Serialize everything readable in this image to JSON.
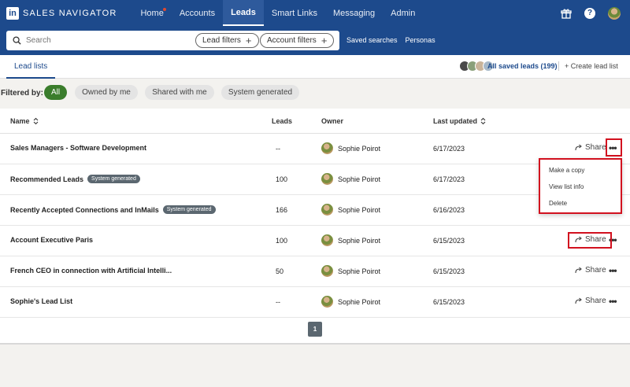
{
  "brand": {
    "logo": "in",
    "name": "SALES NAVIGATOR"
  },
  "nav": [
    {
      "label": "Home",
      "active": false,
      "dot": true
    },
    {
      "label": "Accounts",
      "active": false,
      "dot": false
    },
    {
      "label": "Leads",
      "active": true,
      "dot": false
    },
    {
      "label": "Smart Links",
      "active": false,
      "dot": false
    },
    {
      "label": "Messaging",
      "active": false,
      "dot": false
    },
    {
      "label": "Admin",
      "active": false,
      "dot": false
    }
  ],
  "topright": {
    "help_glyph": "?",
    "icons": [
      "gift-icon",
      "help-icon",
      "avatar"
    ]
  },
  "search": {
    "placeholder": "Search",
    "lead_filters": "Lead filters",
    "account_filters": "Account filters",
    "plus": "+"
  },
  "saved": {
    "searches": "Saved searches",
    "personas": "Personas"
  },
  "tabs": {
    "lead_lists": "Lead lists"
  },
  "leads_summary": {
    "all_saved": "All saved leads (199)",
    "create": "+ Create lead list"
  },
  "filters": {
    "label": "Filtered by:",
    "chips": [
      "All",
      "Owned by me",
      "Shared with me",
      "System generated"
    ]
  },
  "table": {
    "headers": {
      "name": "Name",
      "leads": "Leads",
      "owner": "Owner",
      "updated": "Last updated"
    },
    "rows": [
      {
        "name": "Sales Managers - Software Development",
        "badge": "",
        "leads": "--",
        "owner": "Sophie Poirot",
        "updated": "6/17/2023",
        "share": "Share"
      },
      {
        "name": "Recommended Leads",
        "badge": "System generated",
        "leads": "100",
        "owner": "Sophie Poirot",
        "updated": "6/17/2023",
        "share": "Share"
      },
      {
        "name": "Recently Accepted Connections and InMails",
        "badge": "System generated",
        "leads": "166",
        "owner": "Sophie Poirot",
        "updated": "6/16/2023",
        "share": "Share"
      },
      {
        "name": "Account Executive Paris",
        "badge": "",
        "leads": "100",
        "owner": "Sophie Poirot",
        "updated": "6/15/2023",
        "share": "Share"
      },
      {
        "name": "French CEO in connection with Artificial Intelli...",
        "badge": "",
        "leads": "50",
        "owner": "Sophie Poirot",
        "updated": "6/15/2023",
        "share": "Share"
      },
      {
        "name": "Sophie's Lead List",
        "badge": "",
        "leads": "--",
        "owner": "Sophie Poirot",
        "updated": "6/15/2023",
        "share": "Share"
      }
    ]
  },
  "menu": {
    "items": [
      "Make a copy",
      "View list info",
      "Delete"
    ]
  },
  "pagination": {
    "current": "1"
  },
  "colors": {
    "brand": "#1d4a8c",
    "active_chip": "#3a7d2c",
    "highlight": "#d2111f",
    "badge": "#5b6770"
  }
}
